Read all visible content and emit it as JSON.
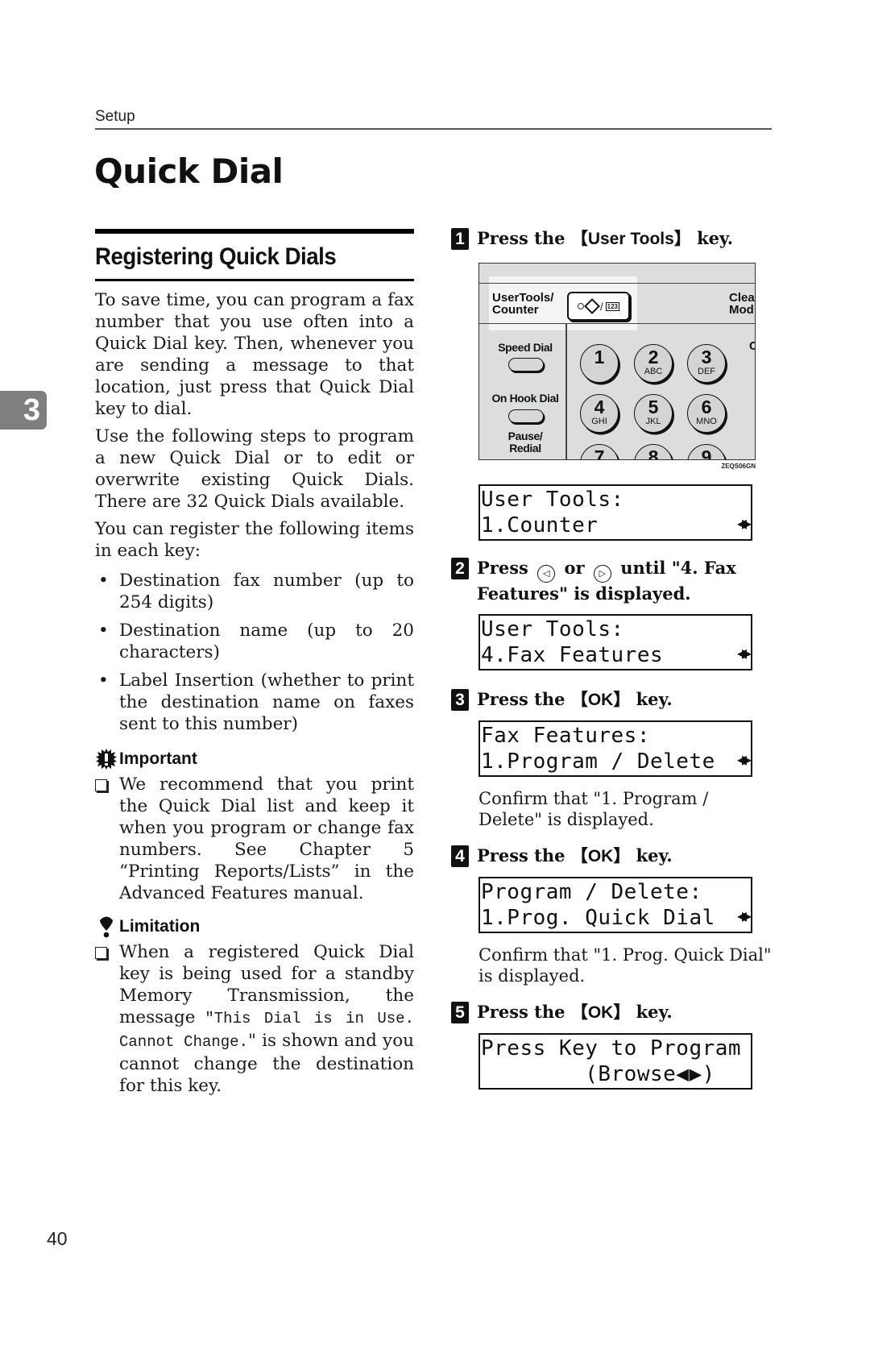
{
  "header": {
    "running_head": "Setup"
  },
  "chapter_tab": "3",
  "page_title": "Quick Dial",
  "page_number": "40",
  "left": {
    "section_title": "Registering Quick Dials",
    "intro": "To save time, you can program a fax number that you use often into a Quick Dial key. Then, whenever you are sending a message to that location, just press that Quick Dial key to dial.",
    "para2": "Use the following steps to program a new Quick Dial or to edit or overwrite existing Quick Dials. There are 32 Quick Dials available.",
    "para3": "You can register the following items in each key:",
    "bullets": [
      "Destination fax number (up to 254 digits)",
      "Destination name (up to 20 characters)",
      "Label Insertion (whether to print the destination name on faxes sent to this number)"
    ],
    "important": {
      "title": "Important",
      "text": "We recommend that you print the Quick Dial list and keep it when you program or change fax numbers. See Chapter 5 “Printing Reports/Lists” in the Advanced Features manual."
    },
    "limitation": {
      "title": "Limitation",
      "text_before": "When a registered Quick Dial key is being used for a standby Memory Transmission, the message ",
      "mono": "\"This Dial is in Use. Cannot Change.",
      "text_after": "\" is shown and you cannot change the destination for this key."
    }
  },
  "steps": [
    {
      "num": "1",
      "pre": "Press the ",
      "key": "User Tools",
      "post": " key.",
      "lcd": [
        "User Tools:",
        "1.Counter"
      ]
    },
    {
      "num": "2",
      "pre": "Press ",
      "left_btn": "◁",
      "mid": " or ",
      "right_btn": "▷",
      "post": " until \"4. Fax Features\" is displayed.",
      "lcd": [
        "User Tools:",
        "4.Fax Features"
      ]
    },
    {
      "num": "3",
      "pre": "Press the ",
      "key": "OK",
      "post": " key.",
      "lcd": [
        "Fax Features:",
        "1.Program / Delete"
      ],
      "confirm": "Confirm that \"1. Program / Delete\" is displayed."
    },
    {
      "num": "4",
      "pre": "Press the ",
      "key": "OK",
      "post": " key.",
      "lcd": [
        "Program / Delete:",
        "1.Prog. Quick Dial"
      ],
      "confirm": "Confirm that \"1. Prog. Quick Dial\" is displayed."
    },
    {
      "num": "5",
      "pre": "Press the ",
      "key": "OK",
      "post": " key.",
      "lcd": [
        "Press Key to Program",
        "        (Browse◀▶)"
      ]
    }
  ],
  "lcd_arrow": "◀▶",
  "bracket_open": "【",
  "bracket_close": "】",
  "panel": {
    "user_tools_label_1": "UserTools/",
    "user_tools_label_2": "Counter",
    "key_slash": "/",
    "key_badge": "123",
    "clear_label_1": "Clea",
    "clear_label_2": "Mod",
    "c_label": "C",
    "speed_dial": "Speed Dial",
    "on_hook_dial": "On Hook Dial",
    "pause_redial_1": "Pause/",
    "pause_redial_2": "Redial",
    "keys": [
      {
        "n": "1",
        "s": ""
      },
      {
        "n": "2",
        "s": "ABC"
      },
      {
        "n": "3",
        "s": "DEF"
      },
      {
        "n": "4",
        "s": "GHI"
      },
      {
        "n": "5",
        "s": "JKL"
      },
      {
        "n": "6",
        "s": "MNO"
      },
      {
        "n": "7",
        "s": ""
      },
      {
        "n": "8",
        "s": ""
      },
      {
        "n": "9",
        "s": ""
      }
    ],
    "figure_code": "ZEQS06GN"
  }
}
